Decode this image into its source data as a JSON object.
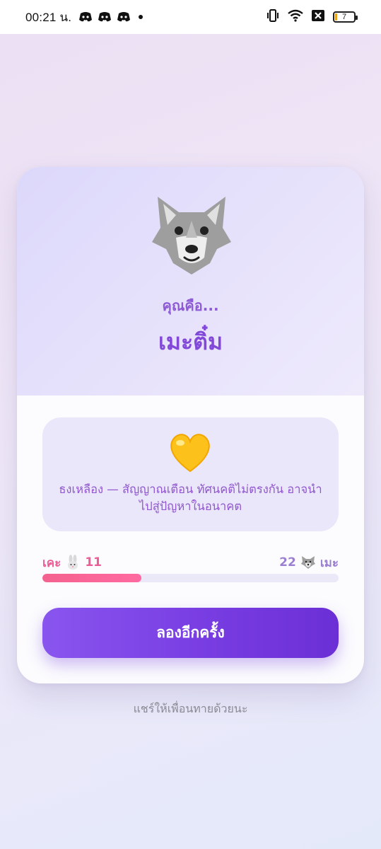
{
  "status_bar": {
    "time": "00:21 น.",
    "battery_level": "7",
    "icons": [
      "discord-icon",
      "discord-icon",
      "discord-icon",
      "dot-icon",
      "vibrate-icon",
      "wifi-icon",
      "data-off-icon",
      "battery-icon"
    ]
  },
  "result": {
    "icon": "wolf-icon",
    "intro": "คุณคือ...",
    "name": "เมะติ๋ม"
  },
  "flag": {
    "icon": "yellow-heart-icon",
    "text": "ธงเหลือง — สัญญาณเตือน ทัศนคติไม่ตรงกัน อาจนำไปสู่ปัญหาในอนาคต"
  },
  "score": {
    "left_label": "เคะ",
    "left_icon": "rabbit-icon",
    "left_value": "11",
    "right_label": "เมะ",
    "right_icon": "wolf-icon",
    "right_value": "22",
    "left_fraction": 0.333
  },
  "colors": {
    "accent": "#7a3fe3",
    "score_pink": "#f4628f",
    "card_top": "#dcd8fb"
  },
  "retry_button": {
    "label": "ลองอีกครั้ง"
  },
  "share_text": "แชร์ให้เพื่อนทายด้วยนะ"
}
